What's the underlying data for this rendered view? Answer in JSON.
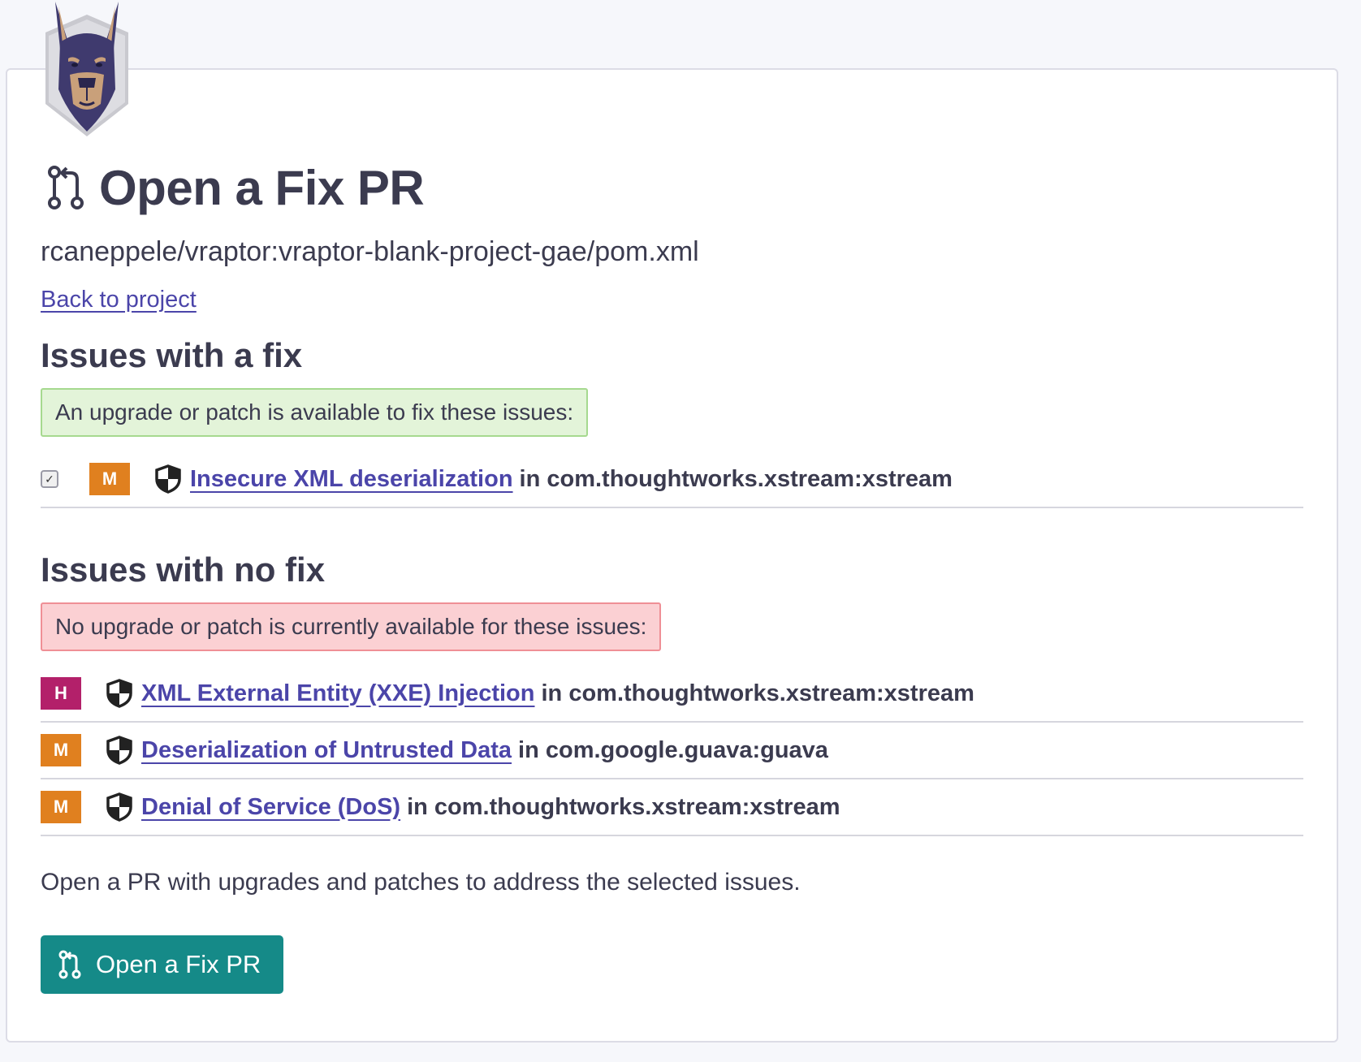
{
  "header": {
    "logo_icon": "doberman-logo-icon",
    "title": "Open a Fix PR",
    "title_icon": "pull-request-icon",
    "project_path": "rcaneppele/vraptor:vraptor-blank-project-gae/pom.xml",
    "back_link": "Back to project"
  },
  "fixable": {
    "heading": "Issues with a fix",
    "notice": "An upgrade or patch is available to fix these issues:",
    "items": [
      {
        "checked": true,
        "severity": "M",
        "title": "Insecure XML deserialization",
        "package": "in com.thoughtworks.xstream:xstream"
      }
    ]
  },
  "unfixable": {
    "heading": "Issues with no fix",
    "notice": "No upgrade or patch is currently available for these issues:",
    "items": [
      {
        "severity": "H",
        "title": "XML External Entity (XXE) Injection",
        "package": "in com.thoughtworks.xstream:xstream"
      },
      {
        "severity": "M",
        "title": "Deserialization of Untrusted Data",
        "package": "in com.google.guava:guava"
      },
      {
        "severity": "M",
        "title": "Denial of Service (DoS)",
        "package": "in com.thoughtworks.xstream:xstream"
      }
    ]
  },
  "footer": {
    "description": "Open a PR with upgrades and patches to address the selected issues.",
    "button_label": "Open a Fix PR"
  },
  "colors": {
    "severity_medium": "#e0801f",
    "severity_high": "#b3206a",
    "link": "#4b45a9",
    "button": "#158a88"
  }
}
